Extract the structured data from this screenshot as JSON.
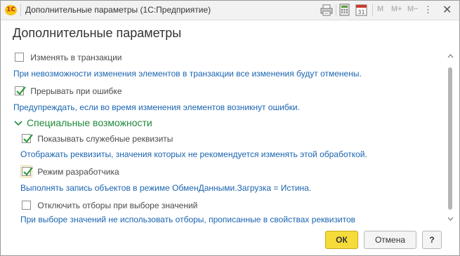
{
  "window": {
    "title": "Дополнительные параметры  (1С:Предприятие)",
    "logo_text": "1С",
    "toolbar": {
      "m_label": "M",
      "mplus_label": "M+",
      "mminus_label": "M−",
      "close_glyph": "✕",
      "menu_glyph": "⋮",
      "calendar_day": "31"
    }
  },
  "form": {
    "title": "Дополнительные параметры",
    "options": [
      {
        "label": "Изменять в транзакции",
        "checked": false,
        "hint": "При невозможности изменения элементов в транзакции все изменения будут отменены."
      },
      {
        "label": "Прерывать при ошибке",
        "checked": true,
        "hint": "Предупреждать, если во время изменения элементов возникнут ошибки."
      }
    ],
    "group": {
      "title": "Специальные возможности",
      "expanded": true,
      "options": [
        {
          "label": "Показывать служебные реквизиты",
          "checked": true,
          "hint": "Отображать реквизиты, значения которых не рекомендуется изменять этой обработкой."
        },
        {
          "label": "Режим разработчика",
          "checked": true,
          "focused": true,
          "hint": "Выполнять запись объектов в режиме ОбменДанными.Загрузка = Истина."
        },
        {
          "label": "Отключить отборы при выборе значений",
          "checked": false,
          "hint": "При выборе значений не использовать отборы, прописанные в свойствах реквизитов"
        }
      ]
    }
  },
  "buttons": {
    "ok": "ОК",
    "cancel": "Отмена",
    "help": "?"
  },
  "colors": {
    "hint_text": "#1a64b0",
    "group_title": "#1d8a3a",
    "ok_button": "#f6dc3b",
    "checkmark": "#2f9a3a",
    "focus_outline": "#e3b11b"
  }
}
